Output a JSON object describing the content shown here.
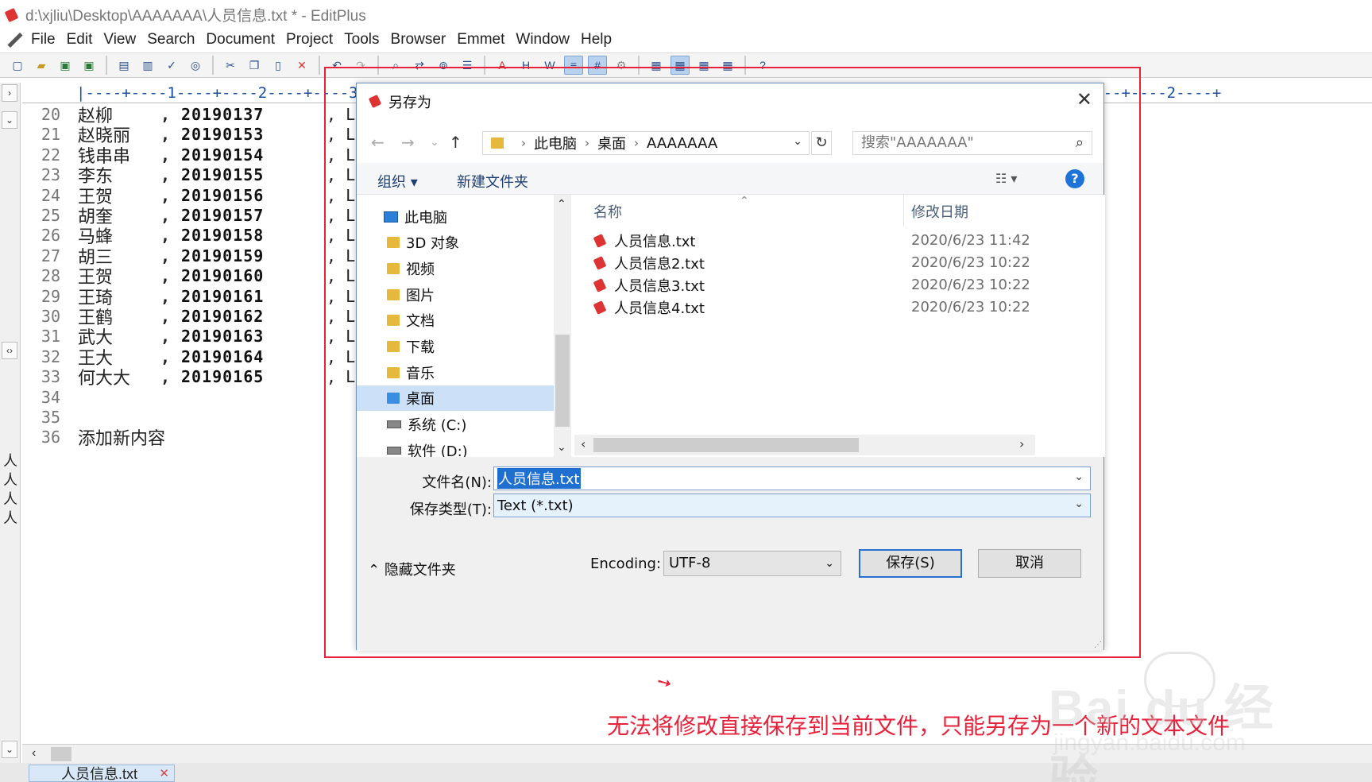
{
  "window": {
    "title": "d:\\xjliu\\Desktop\\AAAAAAA\\人员信息.txt * - EditPlus"
  },
  "menu": [
    "File",
    "Edit",
    "View",
    "Search",
    "Document",
    "Project",
    "Tools",
    "Browser",
    "Emmet",
    "Window",
    "Help"
  ],
  "ruler": {
    "text": "|----+----1----+----2----+----3----+----4----+----5----+----6----+----7----+----8----+----9----+----0----+----1----+----2----+"
  },
  "left_panel": {
    "vertical_text": "人人人人"
  },
  "editor": {
    "lines": [
      {
        "num": "20",
        "name": "赵柳",
        "comma": ",",
        "id": "20190137",
        "trail": ",  L"
      },
      {
        "num": "21",
        "name": "赵晓丽",
        "comma": ",",
        "id": "20190153",
        "trail": ",  L"
      },
      {
        "num": "22",
        "name": "钱串串",
        "comma": ",",
        "id": "20190154",
        "trail": ",  L"
      },
      {
        "num": "23",
        "name": "李东",
        "comma": ",",
        "id": "20190155",
        "trail": ",  L"
      },
      {
        "num": "24",
        "name": "王贺",
        "comma": ",",
        "id": "20190156",
        "trail": ",  L"
      },
      {
        "num": "25",
        "name": "胡奎",
        "comma": ",",
        "id": "20190157",
        "trail": ",  L"
      },
      {
        "num": "26",
        "name": "马蜂",
        "comma": ",",
        "id": "20190158",
        "trail": ",  L"
      },
      {
        "num": "27",
        "name": "胡三",
        "comma": ",",
        "id": "20190159",
        "trail": ",  L"
      },
      {
        "num": "28",
        "name": "王贺",
        "comma": ",",
        "id": "20190160",
        "trail": ",  L"
      },
      {
        "num": "29",
        "name": "王琦",
        "comma": ",",
        "id": "20190161",
        "trail": ",  L"
      },
      {
        "num": "30",
        "name": "王鹤",
        "comma": ",",
        "id": "20190162",
        "trail": ",  L"
      },
      {
        "num": "31",
        "name": "武大",
        "comma": ",",
        "id": "20190163",
        "trail": ",  L"
      },
      {
        "num": "32",
        "name": "王大",
        "comma": ",",
        "id": "20190164",
        "trail": ",  L"
      },
      {
        "num": "33",
        "name": "何大大",
        "comma": ",",
        "id": "20190165",
        "trail": ",  L"
      },
      {
        "num": "34",
        "name": "",
        "comma": "",
        "id": "",
        "trail": ""
      },
      {
        "num": "35",
        "name": "",
        "comma": "",
        "id": "",
        "trail": ""
      },
      {
        "num": "36",
        "name": "添加新内容",
        "comma": "",
        "id": "",
        "trail": ""
      }
    ]
  },
  "tab": {
    "label": "人员信息.txt"
  },
  "dialog": {
    "title": "另存为",
    "address": {
      "parts": [
        "此电脑",
        "桌面",
        "AAAAAAA"
      ]
    },
    "search_placeholder": "搜索\"AAAAAAA\"",
    "commands": {
      "organize": "组织 ▾",
      "new_folder": "新建文件夹"
    },
    "nav": [
      {
        "label": "此电脑",
        "icon": "pc"
      },
      {
        "label": "3D 对象",
        "icon": "folder"
      },
      {
        "label": "视频",
        "icon": "folder"
      },
      {
        "label": "图片",
        "icon": "folder"
      },
      {
        "label": "文档",
        "icon": "folder"
      },
      {
        "label": "下载",
        "icon": "folder"
      },
      {
        "label": "音乐",
        "icon": "folder"
      },
      {
        "label": "桌面",
        "icon": "folder",
        "selected": true
      },
      {
        "label": "系统 (C:)",
        "icon": "drive"
      },
      {
        "label": "软件 (D:)",
        "icon": "drive"
      }
    ],
    "columns": {
      "name": "名称",
      "modified": "修改日期"
    },
    "files": [
      {
        "name": "人员信息.txt",
        "date": "2020/6/23 11:42"
      },
      {
        "name": "人员信息2.txt",
        "date": "2020/6/23 10:22"
      },
      {
        "name": "人员信息3.txt",
        "date": "2020/6/23 10:22"
      },
      {
        "name": "人员信息4.txt",
        "date": "2020/6/23 10:22"
      }
    ],
    "filename_label": "文件名(N):",
    "filename_value": "人员信息.txt",
    "filetype_label": "保存类型(T):",
    "filetype_value": "Text (*.txt)",
    "hide_folders": "隐藏文件夹",
    "encoding_label": "Encoding:",
    "encoding_value": "UTF-8",
    "save_button": "保存(S)",
    "cancel_button": "取消"
  },
  "annotation": "无法将修改直接保存到当前文件，只能另存为一个新的文本文件",
  "watermark": {
    "big": "Bai du 经验",
    "small": "jingyan.baidu.com"
  },
  "colors": {
    "annotation_red": "#e8213a",
    "selection_blue": "#1e6fd0",
    "nav_selected": "#cce0f7"
  }
}
